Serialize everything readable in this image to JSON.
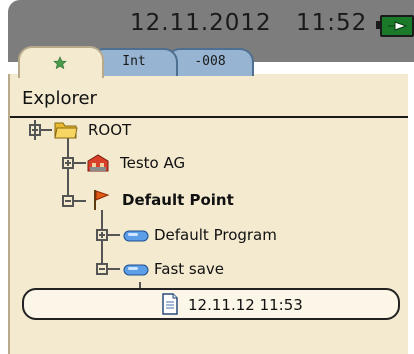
{
  "status": {
    "date": "12.11.2012",
    "time": "11:52",
    "battery_icon": "battery-charging-icon"
  },
  "tabs": [
    {
      "label": "",
      "icon": "star-icon",
      "active": true
    },
    {
      "label": "Int",
      "active": false
    },
    {
      "label": "-008",
      "active": false
    }
  ],
  "explorer": {
    "title": "Explorer",
    "tree": [
      {
        "label": "ROOT",
        "icon": "folder-icon",
        "level": 0
      },
      {
        "label": "Testo AG",
        "icon": "company-icon",
        "level": 1
      },
      {
        "label": "Default Point",
        "icon": "flag-icon",
        "level": 1,
        "bold": true
      },
      {
        "label": "Default Program",
        "icon": "program-icon",
        "level": 2
      },
      {
        "label": "Fast save",
        "icon": "program-icon",
        "level": 2
      },
      {
        "label": "12.11.12 11:53",
        "icon": "document-icon",
        "level": 3,
        "selected": true
      }
    ]
  },
  "colors": {
    "statusbar": "#7d7d7d",
    "panel": "#f3ead0",
    "tab_inactive": "#97b5d3",
    "battery": "#1b7a2a"
  }
}
